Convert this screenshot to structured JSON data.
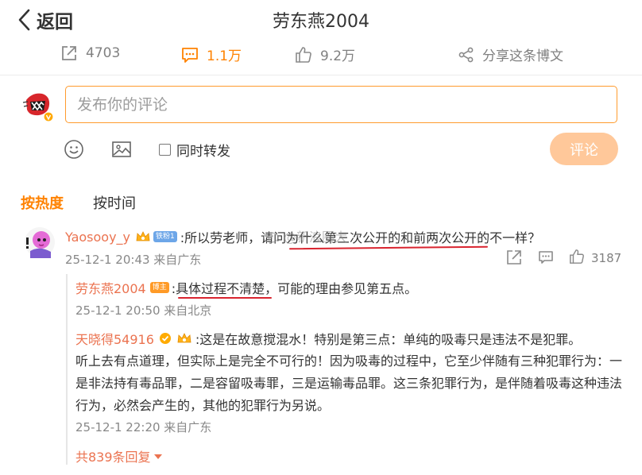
{
  "header": {
    "back_label": "返回",
    "title": "劳东燕2004"
  },
  "stats": {
    "repost_count": "4703",
    "comment_count": "1.1万",
    "like_count": "9.2万",
    "share_label": "分享这条博文"
  },
  "composer": {
    "placeholder": "发布你的评论",
    "repost_label": "同时转发",
    "submit_label": "评论"
  },
  "sort_tabs": {
    "hot": "按热度",
    "time": "按时间"
  },
  "comment": {
    "user": "Yaosooy_y",
    "fan_badge": "铁粉1",
    "text": ":所以劳老师，请问为什么第三次公开的和前两次公开的不一样？",
    "time": "25-12-1 20:43 来自广东",
    "like_count": "3187",
    "watermark": "@新浪圈大",
    "replies": [
      {
        "user": "劳东燕2004",
        "owner_badge": "博主",
        "text": ":具体过程不清楚，可能的理由参见第五点。",
        "time": "25-12-1 20:50 来自北京"
      },
      {
        "user": "天晓得54916",
        "text_lead": ":这是在故意搅混水！特别是第三点：单纯的吸毒只是违法不是犯罪。",
        "text_rest": "听上去有点道理，但实际上是完全不可行的！因为吸毒的过程中，它至少伴随有三种犯罪行为：一是非法持有毒品罪，二是容留吸毒罪，三是运输毒品罪。这三条犯罪行为，是伴随着吸毒这种违法行为，必然会产生的，其他的犯罪行为另说。",
        "time": "25-12-1 22:20 来自广东"
      }
    ],
    "more_replies": "共839条回复"
  },
  "colors": {
    "accent": "#ff8200",
    "username": "#eb7350",
    "submit_disabled": "#ffc89a",
    "annotation_red": "#d9242f"
  }
}
